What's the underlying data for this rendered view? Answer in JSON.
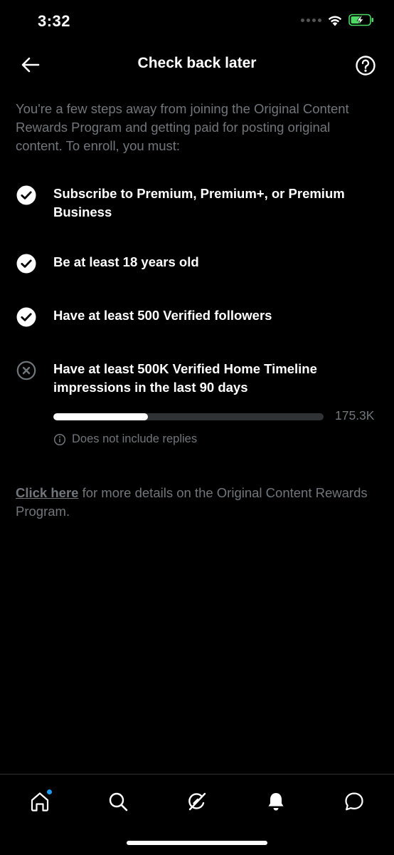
{
  "status_bar": {
    "time": "3:32"
  },
  "header": {
    "title": "Check back later"
  },
  "intro": "You're a few steps away from joining the Original Content Rewards Program and getting paid for posting original content. To enroll, you must:",
  "requirements": [
    {
      "text": "Subscribe to Premium, Premium+, or Premium Business",
      "status": "met"
    },
    {
      "text": "Be at least 18 years old",
      "status": "met"
    },
    {
      "text": "Have at least 500 Verified followers",
      "status": "met"
    },
    {
      "text": "Have at least 500K Verified Home Timeline impressions in the last 90 days",
      "status": "not-met"
    }
  ],
  "progress": {
    "value_label": "175.3K",
    "fraction": 0.35,
    "note": "Does not include replies"
  },
  "footer": {
    "link_text": "Click here",
    "rest_text": " for more details on the Original Content Rewards Program."
  },
  "colors": {
    "background": "#000000",
    "muted_text": "#71767b",
    "accent_blue": "#1d9bf0",
    "battery_green": "#4cd964"
  },
  "nav": {
    "items": [
      "home-icon",
      "search-icon",
      "grok-icon",
      "notifications-icon",
      "messages-icon"
    ]
  }
}
